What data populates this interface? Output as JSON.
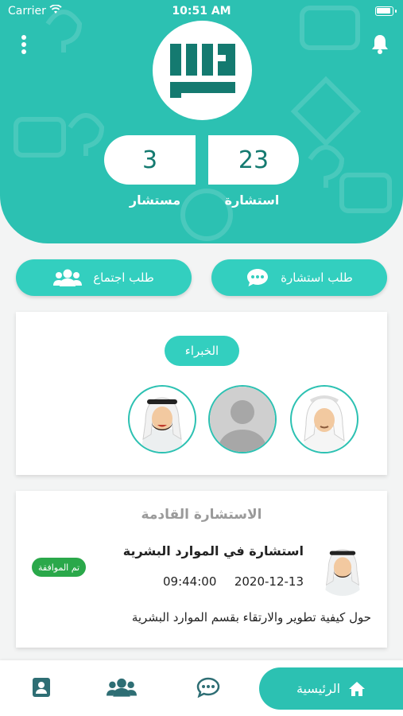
{
  "status_bar": {
    "carrier": "Carrier",
    "time": "10:51 AM"
  },
  "header": {
    "logo_icon": "kufic-logo",
    "menu_icon": "more-vertical-icon",
    "bell_icon": "bell-icon",
    "stats": [
      {
        "value": "3",
        "label": "مستشار"
      },
      {
        "value": "23",
        "label": "استشارة"
      }
    ]
  },
  "actions": {
    "meeting_label": "طلب اجتماع",
    "consult_label": "طلب استشارة"
  },
  "experts": {
    "tag": "الخبراء",
    "items": [
      {
        "name": "expert-1",
        "icon": "man-avatar-icon"
      },
      {
        "name": "expert-2",
        "icon": "person-placeholder-icon"
      },
      {
        "name": "expert-3",
        "icon": "man-avatar-icon"
      }
    ]
  },
  "upcoming": {
    "section_title": "الاستشارة القادمة",
    "title": "استشارة في الموارد البشرية",
    "date": "2020-12-13",
    "time": "09:44:00",
    "status": "تم الموافقة",
    "description": "حول كيفية تطوير والارتقاء بقسم الموارد البشرية"
  },
  "tabbar": {
    "home_label": "الرئيسية"
  },
  "colors": {
    "accent": "#2cc1b2",
    "accent_light": "#33cfbf",
    "success": "#2aa84a"
  }
}
